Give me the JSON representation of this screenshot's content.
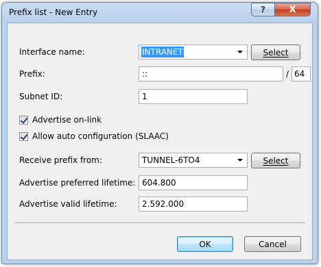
{
  "window": {
    "title": "Prefix list - New Entry",
    "help_glyph": "?",
    "close_glyph": "X"
  },
  "form": {
    "interface_label": "Interface name:",
    "interface_value": "INTRANET",
    "interface_select_label": "Select",
    "prefix_label": "Prefix:",
    "prefix_value": "::",
    "prefix_slash": "/",
    "prefix_length": "64",
    "subnet_label": "Subnet ID:",
    "subnet_value": "1",
    "advertise_onlink_label": "Advertise on-link",
    "advertise_onlink_checked": true,
    "slaac_label": "Allow auto configuration (SLAAC)",
    "slaac_checked": true,
    "receive_label": "Receive prefix from:",
    "receive_value": "TUNNEL-6TO4",
    "receive_select_label": "Select",
    "preferred_label": "Advertise preferred lifetime:",
    "preferred_value": "604.800",
    "valid_label": "Advertise valid lifetime:",
    "valid_value": "2.592.000"
  },
  "buttons": {
    "ok": "OK",
    "cancel": "Cancel"
  },
  "colors": {
    "selection": "#3399ff",
    "close_button": "#c33c1f",
    "titlebar": "#c9dcf1"
  },
  "icons": {
    "help": "question-mark",
    "close": "x",
    "dropdown": "chevron-down",
    "check": "checkmark"
  }
}
